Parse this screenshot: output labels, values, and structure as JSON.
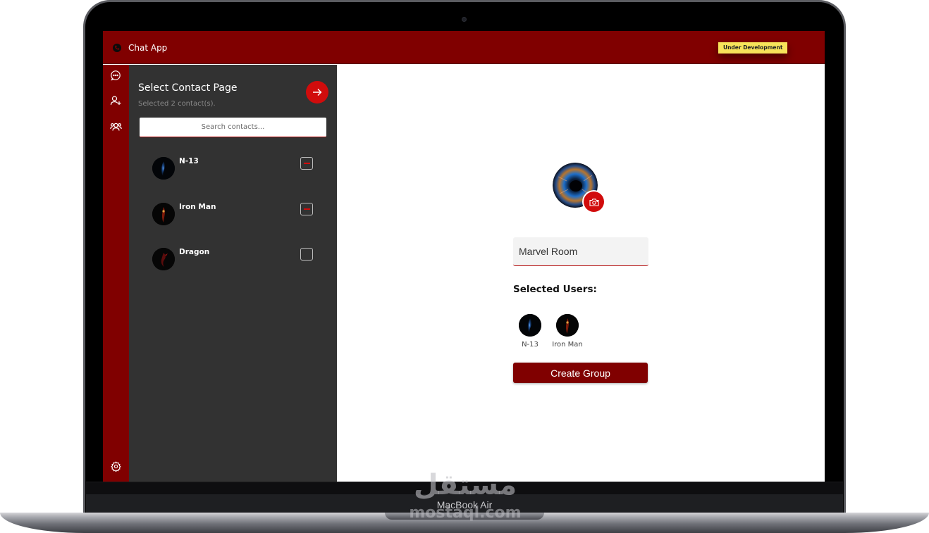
{
  "app": {
    "title": "Chat App",
    "badge": "Under Development",
    "colors": {
      "primary": "#800000",
      "accent": "#d10c0c",
      "panel": "#323232",
      "badge": "#f7e35a"
    }
  },
  "sidebar": {
    "icons": [
      "chat-bubble-icon",
      "add-user-icon",
      "group-icon",
      "settings-icon"
    ]
  },
  "contact_panel": {
    "title": "Select Contact Page",
    "subtitle": "Selected 2 contact(s).",
    "search_placeholder": "Search contacts...",
    "contacts": [
      {
        "name": "N-13",
        "selected": true
      },
      {
        "name": "Iron Man",
        "selected": true
      },
      {
        "name": "Dragon",
        "selected": false
      }
    ]
  },
  "group_form": {
    "group_name": "Marvel Room",
    "selected_heading": "Selected Users:",
    "selected_users": [
      {
        "name": "N-13"
      },
      {
        "name": "Iron Man"
      }
    ],
    "create_label": "Create Group"
  },
  "device": {
    "label": "MacBook Air"
  },
  "watermark": {
    "logo_text": "مستقل",
    "site": "mostaql.com"
  }
}
